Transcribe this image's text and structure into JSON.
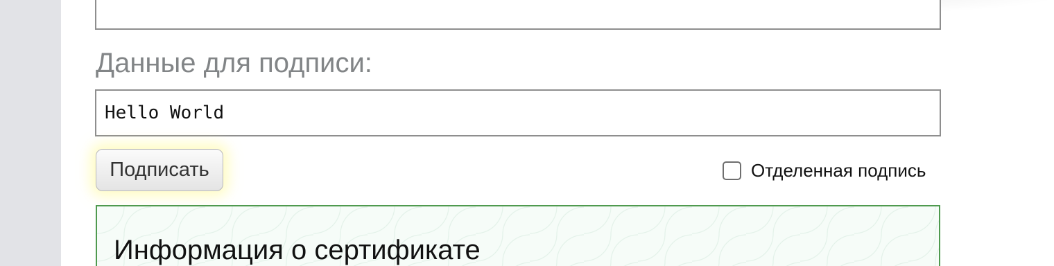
{
  "form": {
    "data_label": "Данные для подписи:",
    "data_value": "Hello World",
    "sign_button": "Подписать",
    "detached_label": "Отделенная подпись",
    "detached_checked": false
  },
  "certificate": {
    "title": "Информация о сертификате"
  },
  "colors": {
    "panel_border": "#4f9a4f",
    "button_glow": "#fffa96",
    "label_gray": "#828587"
  }
}
